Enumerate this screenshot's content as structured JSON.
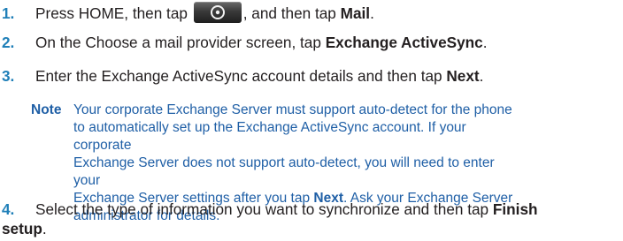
{
  "steps": [
    {
      "number": "1.",
      "text_before": "Press HOME, then tap",
      "icon": "apps-launcher-icon",
      "text_after": ", and then tap",
      "emphasis": "Mail",
      "text_end": "."
    },
    {
      "number": "2.",
      "text_before": "On the Choose a mail provider screen, tap",
      "emphasis": "Exchange ActiveSync",
      "text_end": "."
    },
    {
      "number": "3.",
      "text_before": "Enter the Exchange ActiveSync account details and then tap",
      "emphasis": "Next",
      "text_end": "."
    },
    {
      "number": "4.",
      "text_before": "Select the type of information you want to synchronize and then tap",
      "emphasis": "Finish",
      "continuation": "setup",
      "text_end": "."
    }
  ],
  "note": {
    "label": "Note",
    "line1": "Your corporate Exchange Server must support auto-detect for the phone",
    "line2": "to automatically set up the Exchange ActiveSync account. If your corporate",
    "line3": "Exchange Server does not support auto-detect, you will need to enter your",
    "line4_before": "Exchange Server settings after you tap",
    "line4_emphasis": "Next",
    "line4_after": ". Ask your Exchange Server",
    "line5": "administrator for details."
  },
  "colors": {
    "step_number": "#1f7fb8",
    "body_text": "#231f20",
    "note_text": "#1f5fa6"
  }
}
